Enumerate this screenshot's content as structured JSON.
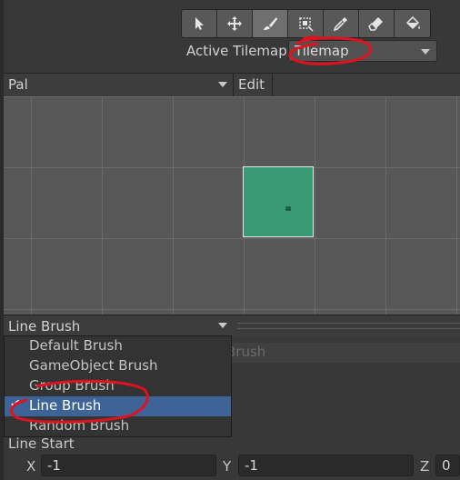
{
  "toolbar": {
    "tools": [
      "select-tool",
      "move-tool",
      "paint-brush-tool",
      "box-fill-tool",
      "picker-tool",
      "eraser-tool",
      "flood-fill-tool"
    ],
    "active_index": 2
  },
  "active_tilemap": {
    "label": "Active Tilemap",
    "value": "Tilemap"
  },
  "palette": {
    "selected": "Pal",
    "edit_label": "Edit"
  },
  "brush": {
    "selected": "Line Brush",
    "options": [
      "Default Brush",
      "GameObject Brush",
      "Group Brush",
      "Line Brush",
      "Random Brush"
    ],
    "selected_index": 3,
    "ghost_text": "Brush"
  },
  "line_start": {
    "label": "Line Start",
    "x_label": "X",
    "x_value": "-1",
    "y_label": "Y",
    "y_value": "-1",
    "z_label": "Z",
    "z_value": "0"
  },
  "colors": {
    "tile": "#3b9a76",
    "selection": "#3e6396",
    "annotation": "#e0121d"
  }
}
